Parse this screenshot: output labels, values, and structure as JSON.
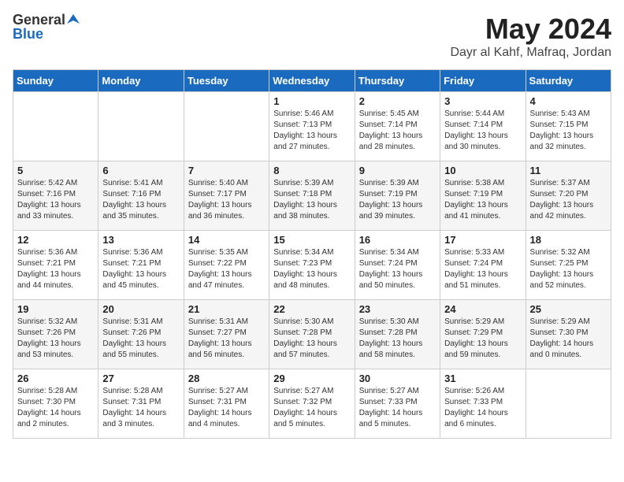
{
  "logo": {
    "general": "General",
    "blue": "Blue"
  },
  "title": {
    "month": "May 2024",
    "location": "Dayr al Kahf, Mafraq, Jordan"
  },
  "days_header": [
    "Sunday",
    "Monday",
    "Tuesday",
    "Wednesday",
    "Thursday",
    "Friday",
    "Saturday"
  ],
  "weeks": [
    [
      {
        "day": "",
        "content": ""
      },
      {
        "day": "",
        "content": ""
      },
      {
        "day": "",
        "content": ""
      },
      {
        "day": "1",
        "content": "Sunrise: 5:46 AM\nSunset: 7:13 PM\nDaylight: 13 hours\nand 27 minutes."
      },
      {
        "day": "2",
        "content": "Sunrise: 5:45 AM\nSunset: 7:14 PM\nDaylight: 13 hours\nand 28 minutes."
      },
      {
        "day": "3",
        "content": "Sunrise: 5:44 AM\nSunset: 7:14 PM\nDaylight: 13 hours\nand 30 minutes."
      },
      {
        "day": "4",
        "content": "Sunrise: 5:43 AM\nSunset: 7:15 PM\nDaylight: 13 hours\nand 32 minutes."
      }
    ],
    [
      {
        "day": "5",
        "content": "Sunrise: 5:42 AM\nSunset: 7:16 PM\nDaylight: 13 hours\nand 33 minutes."
      },
      {
        "day": "6",
        "content": "Sunrise: 5:41 AM\nSunset: 7:16 PM\nDaylight: 13 hours\nand 35 minutes."
      },
      {
        "day": "7",
        "content": "Sunrise: 5:40 AM\nSunset: 7:17 PM\nDaylight: 13 hours\nand 36 minutes."
      },
      {
        "day": "8",
        "content": "Sunrise: 5:39 AM\nSunset: 7:18 PM\nDaylight: 13 hours\nand 38 minutes."
      },
      {
        "day": "9",
        "content": "Sunrise: 5:39 AM\nSunset: 7:19 PM\nDaylight: 13 hours\nand 39 minutes."
      },
      {
        "day": "10",
        "content": "Sunrise: 5:38 AM\nSunset: 7:19 PM\nDaylight: 13 hours\nand 41 minutes."
      },
      {
        "day": "11",
        "content": "Sunrise: 5:37 AM\nSunset: 7:20 PM\nDaylight: 13 hours\nand 42 minutes."
      }
    ],
    [
      {
        "day": "12",
        "content": "Sunrise: 5:36 AM\nSunset: 7:21 PM\nDaylight: 13 hours\nand 44 minutes."
      },
      {
        "day": "13",
        "content": "Sunrise: 5:36 AM\nSunset: 7:21 PM\nDaylight: 13 hours\nand 45 minutes."
      },
      {
        "day": "14",
        "content": "Sunrise: 5:35 AM\nSunset: 7:22 PM\nDaylight: 13 hours\nand 47 minutes."
      },
      {
        "day": "15",
        "content": "Sunrise: 5:34 AM\nSunset: 7:23 PM\nDaylight: 13 hours\nand 48 minutes."
      },
      {
        "day": "16",
        "content": "Sunrise: 5:34 AM\nSunset: 7:24 PM\nDaylight: 13 hours\nand 50 minutes."
      },
      {
        "day": "17",
        "content": "Sunrise: 5:33 AM\nSunset: 7:24 PM\nDaylight: 13 hours\nand 51 minutes."
      },
      {
        "day": "18",
        "content": "Sunrise: 5:32 AM\nSunset: 7:25 PM\nDaylight: 13 hours\nand 52 minutes."
      }
    ],
    [
      {
        "day": "19",
        "content": "Sunrise: 5:32 AM\nSunset: 7:26 PM\nDaylight: 13 hours\nand 53 minutes."
      },
      {
        "day": "20",
        "content": "Sunrise: 5:31 AM\nSunset: 7:26 PM\nDaylight: 13 hours\nand 55 minutes."
      },
      {
        "day": "21",
        "content": "Sunrise: 5:31 AM\nSunset: 7:27 PM\nDaylight: 13 hours\nand 56 minutes."
      },
      {
        "day": "22",
        "content": "Sunrise: 5:30 AM\nSunset: 7:28 PM\nDaylight: 13 hours\nand 57 minutes."
      },
      {
        "day": "23",
        "content": "Sunrise: 5:30 AM\nSunset: 7:28 PM\nDaylight: 13 hours\nand 58 minutes."
      },
      {
        "day": "24",
        "content": "Sunrise: 5:29 AM\nSunset: 7:29 PM\nDaylight: 13 hours\nand 59 minutes."
      },
      {
        "day": "25",
        "content": "Sunrise: 5:29 AM\nSunset: 7:30 PM\nDaylight: 14 hours\nand 0 minutes."
      }
    ],
    [
      {
        "day": "26",
        "content": "Sunrise: 5:28 AM\nSunset: 7:30 PM\nDaylight: 14 hours\nand 2 minutes."
      },
      {
        "day": "27",
        "content": "Sunrise: 5:28 AM\nSunset: 7:31 PM\nDaylight: 14 hours\nand 3 minutes."
      },
      {
        "day": "28",
        "content": "Sunrise: 5:27 AM\nSunset: 7:31 PM\nDaylight: 14 hours\nand 4 minutes."
      },
      {
        "day": "29",
        "content": "Sunrise: 5:27 AM\nSunset: 7:32 PM\nDaylight: 14 hours\nand 5 minutes."
      },
      {
        "day": "30",
        "content": "Sunrise: 5:27 AM\nSunset: 7:33 PM\nDaylight: 14 hours\nand 5 minutes."
      },
      {
        "day": "31",
        "content": "Sunrise: 5:26 AM\nSunset: 7:33 PM\nDaylight: 14 hours\nand 6 minutes."
      },
      {
        "day": "",
        "content": ""
      }
    ]
  ]
}
